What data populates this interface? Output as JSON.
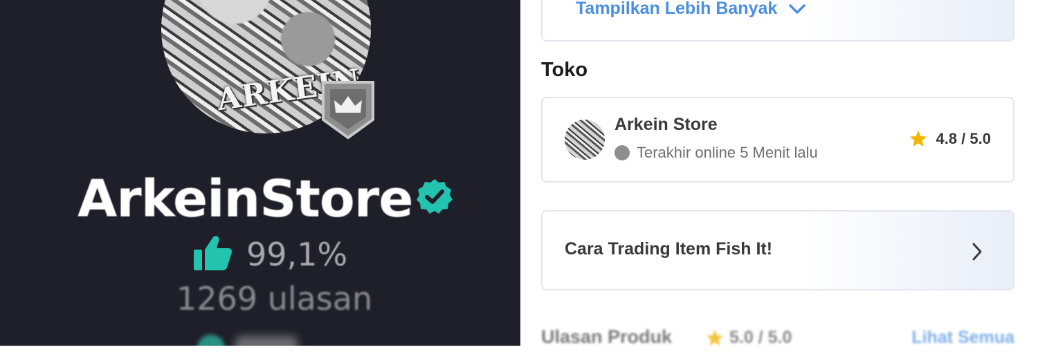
{
  "profile": {
    "avatar_text": "ARKEIN",
    "seller_name": "ArkeinStore",
    "rating_percent": "99,1%",
    "reviews_count": "1269 ulasan",
    "verified": true
  },
  "details": {
    "show_more_label": "Tampilkan Lebih Banyak"
  },
  "store_section": {
    "title": "Toko",
    "store_name": "Arkein Store",
    "status": "Terakhir online 5 Menit lalu",
    "rating": "4.8 / 5.0"
  },
  "guide": {
    "label": "Cara Trading Item Fish It!"
  },
  "product_reviews": {
    "title": "Ulasan Produk",
    "rating": "5.0 / 5.0",
    "see_all_label": "Lihat Semua"
  },
  "colors": {
    "dark_bg": "#1f1f29",
    "accent_teal": "#22c4b0",
    "link_blue": "#4a8fe0",
    "star_yellow": "#f5b400"
  },
  "icons": [
    "crown-badge-icon",
    "verified-icon",
    "thumbs-up-icon",
    "chevron-down-icon",
    "star-icon",
    "chevron-right-icon",
    "status-dot-icon"
  ]
}
